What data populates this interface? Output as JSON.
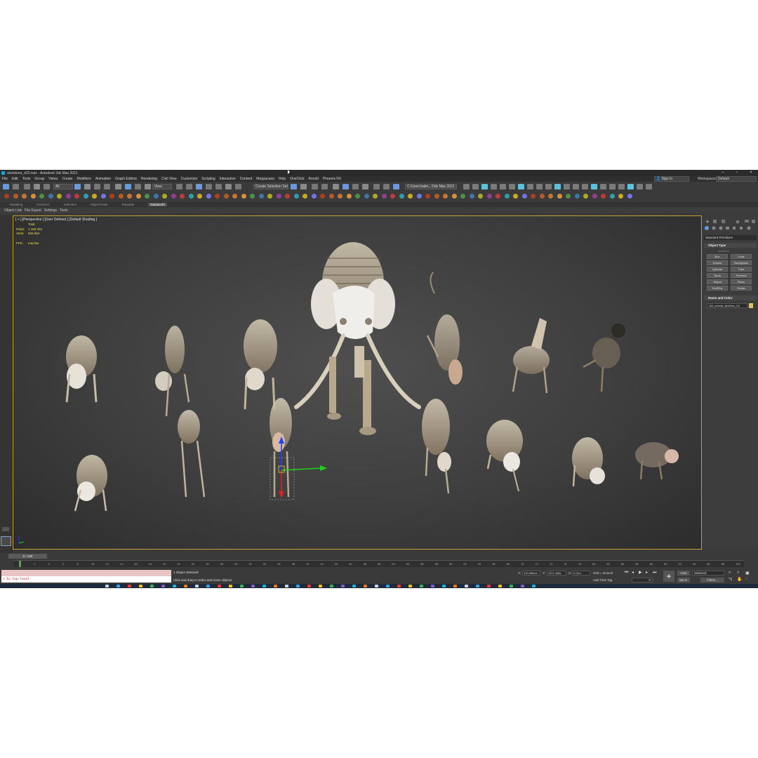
{
  "window": {
    "title": "skeletons_v03.max - Autodesk 3ds Max 2021",
    "sign_in": "Sign In",
    "workspaces_label": "Workspaces:",
    "workspace": "Default"
  },
  "menu": [
    "File",
    "Edit",
    "Tools",
    "Group",
    "Views",
    "Create",
    "Modifiers",
    "Animation",
    "Graph Editors",
    "Rendering",
    "Civil View",
    "Customize",
    "Scripting",
    "Interactive",
    "Content",
    "Megascans",
    "Help",
    "OneClick",
    "Arnold",
    "Phoenix FD"
  ],
  "toolbar": {
    "selection_filter": "All",
    "view": "View",
    "selection_set": "Create Selection Set",
    "project_path": "C:\\Users\\adm...\\3ds Max 2021"
  },
  "ribbon": {
    "tabs": [
      "Modeling",
      "Freeform",
      "Selection",
      "Object Paint",
      "Populate",
      "Dataworth"
    ],
    "active_tab": "Dataworth",
    "links": [
      "Object Link",
      "File Export",
      "Settings",
      "Tools"
    ]
  },
  "viewport": {
    "label": "[ + ] [Perspective ] [User Defined ] [Default Shading ]",
    "stats_title": "Total",
    "polys_label": "Polys:",
    "polys_value": "1 166 204",
    "verts_label": "Verts:",
    "verts_value": "925 654",
    "fps_label": "FPS:",
    "fps_value": "Inactive"
  },
  "command_panel": {
    "category": "Standard Primitives",
    "object_type": "Object Type",
    "autogrid": "AutoGrid",
    "primitives": [
      "Box",
      "Cone",
      "Sphere",
      "GeoSphere",
      "Cylinder",
      "Tube",
      "Torus",
      "Pyramid",
      "Teapot",
      "Plane",
      "TextPlus",
      "Hedra"
    ],
    "name_and_color": "Name and Color",
    "object_name": "SM_animal_skeleton_04",
    "object_color": "#e0c060"
  },
  "timeline": {
    "frame_display": "0 / 100",
    "ticks": [
      "0",
      "2",
      "4",
      "6",
      "8",
      "10",
      "12",
      "14",
      "16",
      "18",
      "20",
      "22",
      "24",
      "26",
      "28",
      "30",
      "32",
      "34",
      "36",
      "38",
      "40",
      "42",
      "44",
      "46",
      "48",
      "50",
      "52",
      "54",
      "56",
      "58",
      "60",
      "62",
      "64",
      "66",
      "68",
      "70",
      "72",
      "74",
      "76",
      "78",
      "80",
      "82",
      "84",
      "86",
      "88",
      "90",
      "92",
      "94",
      "96",
      "98",
      "100"
    ]
  },
  "status": {
    "listener_text": ">  In top-level",
    "message": "1 Object Selected",
    "prompt": "Click and drag to select and move objects",
    "x_label": "X:",
    "x_value": "120,558cm",
    "y_label": "Y:",
    "y_value": "1571,466c",
    "z_label": "Z:",
    "z_value": "0,0cm",
    "grid": "Grid = 10,0cm",
    "add_time_tag": "Add Time Tag",
    "auto": "Auto",
    "set_key": "Set K.",
    "key_filter": "Selected",
    "filters": "Filters...",
    "frame": "0"
  }
}
